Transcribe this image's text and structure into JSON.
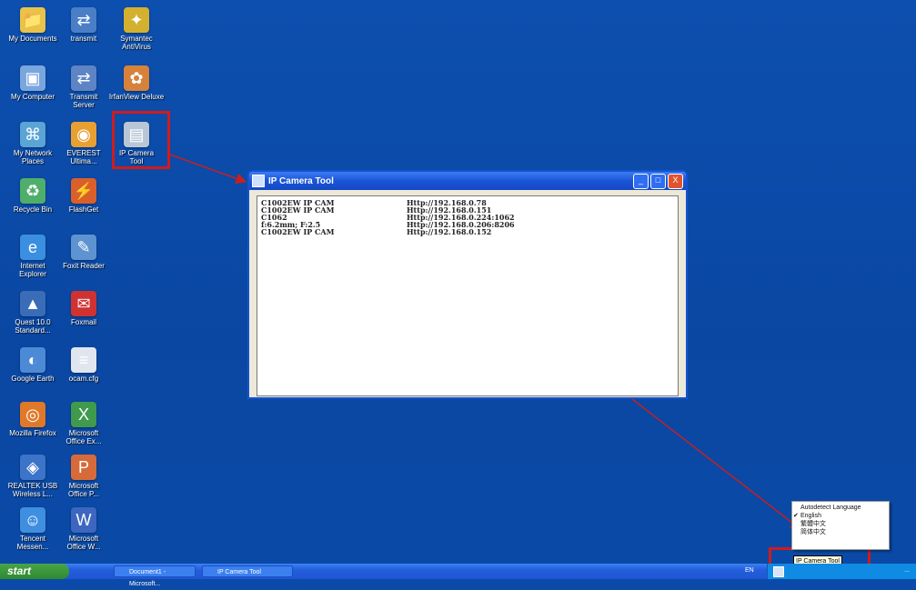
{
  "desktop_icons": [
    {
      "label": "My Documents",
      "color": "#e8c24a",
      "glyph": "📁"
    },
    {
      "label": "transmit",
      "color": "#4a7fc8",
      "glyph": "⇄"
    },
    {
      "label": "Symantec\nAntiVirus",
      "color": "#d4b030",
      "glyph": "✦"
    },
    {
      "label": "My Computer",
      "color": "#7aa6df",
      "glyph": "▣"
    },
    {
      "label": "Transmit\nServer",
      "color": "#5d84c4",
      "glyph": "⇄"
    },
    {
      "label": "IrfanView Deluxe",
      "color": "#d6823c",
      "glyph": "✿"
    },
    {
      "label": "My Network\nPlaces",
      "color": "#5aa4d6",
      "glyph": "⌘"
    },
    {
      "label": "EVEREST\nUltima...",
      "color": "#e8a033",
      "glyph": "◉"
    },
    {
      "label": "IP Camera\nTool",
      "color": "#b9c6d6",
      "glyph": "▤"
    },
    {
      "label": "Recycle Bin",
      "color": "#4fae6b",
      "glyph": "♻"
    },
    {
      "label": "FlashGet",
      "color": "#d9602b",
      "glyph": "⚡"
    },
    {
      "label": "Internet\nExplorer",
      "color": "#3a8fe0",
      "glyph": "e"
    },
    {
      "label": "Foxit Reader",
      "color": "#5d93d0",
      "glyph": "✎"
    },
    {
      "label": "Quest 10.0\nStandard...",
      "color": "#3a6cb8",
      "glyph": "▲"
    },
    {
      "label": "Foxmail",
      "color": "#d03232",
      "glyph": "✉"
    },
    {
      "label": "Google Earth",
      "color": "#4d8ad6",
      "glyph": "◐"
    },
    {
      "label": "ocam.cfg",
      "color": "#dfe6ef",
      "glyph": "≡"
    },
    {
      "label": "Mozilla Firefox",
      "color": "#e0782a",
      "glyph": "◎"
    },
    {
      "label": "Microsoft\nOffice Ex...",
      "color": "#3f9a4e",
      "glyph": "X"
    },
    {
      "label": "REALTEK USB\nWireless L...",
      "color": "#3c74c9",
      "glyph": "◈"
    },
    {
      "label": "Microsoft\nOffice P...",
      "color": "#d76a3a",
      "glyph": "P"
    },
    {
      "label": "Tencent\nMessen...",
      "color": "#3f8fe0",
      "glyph": "☺"
    },
    {
      "label": "Microsoft\nOffice W...",
      "color": "#3d66c0",
      "glyph": "W"
    }
  ],
  "window": {
    "title": "IP Camera Tool",
    "minimize": "_",
    "maximize": "□",
    "close": "X",
    "cameras": [
      {
        "name": "C1002EW IP CAM",
        "url": "Http://192.168.0.78"
      },
      {
        "name": "C1002EW IP CAM",
        "url": "Http://192.168.0.151"
      },
      {
        "name": "C1062",
        "url": "Http://192.168.0.224:1062"
      },
      {
        "name": "f:6.2mm; F:2.5",
        "url": "Http://192.168.0.206:8206"
      },
      {
        "name": "C1002EW IP CAM",
        "url": "Http://192.168.0.152"
      }
    ]
  },
  "context_menu": {
    "items": [
      {
        "label": "Autodetect Language",
        "checked": false
      },
      {
        "label": "English",
        "checked": true
      },
      {
        "label": "繁體中文",
        "checked": false
      },
      {
        "label": "简体中文",
        "checked": false
      }
    ]
  },
  "tooltip": "IP Camera Tool",
  "taskbar": {
    "start": "start",
    "buttons": [
      "Document1 - Microsoft...",
      "IP Camera Tool"
    ],
    "lang": "EN",
    "clock": "..."
  },
  "colors": {
    "highlight": "#d11b1b",
    "desktop": "#0b4aa8"
  }
}
